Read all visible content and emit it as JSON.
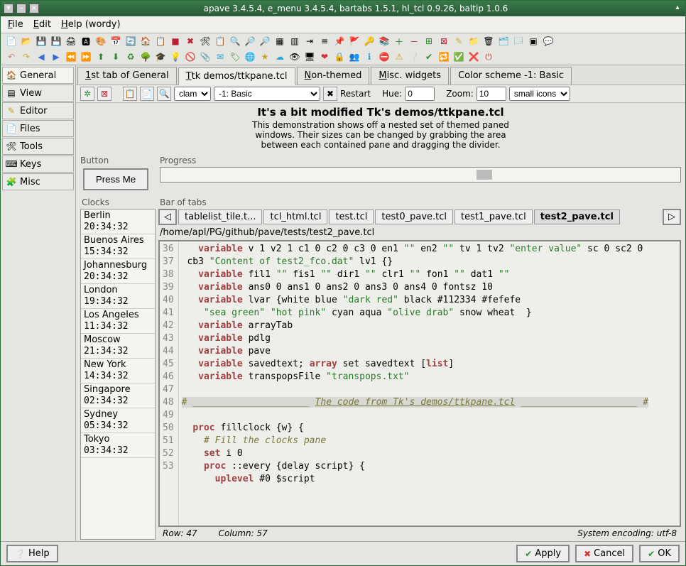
{
  "titlebar": {
    "title": "apave 3.4.5.4,  e_menu 3.4.5.4,  bartabs 1.5.1,  hl_tcl 0.9.26,  baltip 1.0.6"
  },
  "menu": {
    "file": "File",
    "edit": "Edit",
    "help": "Help (wordy)"
  },
  "sidebar": {
    "items": [
      {
        "label": "General"
      },
      {
        "label": "View"
      },
      {
        "label": "Editor"
      },
      {
        "label": "Files"
      },
      {
        "label": "Tools"
      },
      {
        "label": "Keys"
      },
      {
        "label": "Misc"
      }
    ]
  },
  "tabs": [
    {
      "label": "1st tab of General"
    },
    {
      "label": "Ttk demos/ttkpane.tcl"
    },
    {
      "label": "Non-themed"
    },
    {
      "label": "Misc. widgets"
    },
    {
      "label": "Color scheme -1: Basic"
    }
  ],
  "cfg": {
    "theme": "clam",
    "scheme": "-1: Basic",
    "restart": "Restart",
    "hue_lbl": "Hue:",
    "hue": "0",
    "zoom_lbl": "Zoom:",
    "zoom": "10",
    "iconset": "small icons"
  },
  "demo": {
    "title": "It's a bit modified Tk's demos/ttkpane.tcl",
    "desc": "This demonstration shows off a nested set of themed paned windows. Their sizes can be changed by grabbing the area between each contained pane and dragging the divider."
  },
  "button_panel": {
    "label": "Button",
    "text": "Press Me"
  },
  "progress_panel": {
    "label": "Progress"
  },
  "clocks": {
    "label": "Clocks",
    "items": [
      {
        "city": "Berlin",
        "time": "20:34:32"
      },
      {
        "city": "Buenos Aires",
        "time": "15:34:32"
      },
      {
        "city": "Johannesburg",
        "time": "20:34:32"
      },
      {
        "city": "London",
        "time": "19:34:32"
      },
      {
        "city": "Los Angeles",
        "time": "11:34:32"
      },
      {
        "city": "Moscow",
        "time": "21:34:32"
      },
      {
        "city": "New York",
        "time": "14:34:32"
      },
      {
        "city": "Singapore",
        "time": "02:34:32"
      },
      {
        "city": "Sydney",
        "time": "05:34:32"
      },
      {
        "city": "Tokyo",
        "time": "03:34:32"
      }
    ]
  },
  "bar": {
    "label": "Bar of tabs",
    "tabs": [
      {
        "label": "tablelist_tile.t..."
      },
      {
        "label": "tcl_html.tcl"
      },
      {
        "label": "test.tcl"
      },
      {
        "label": "test0_pave.tcl"
      },
      {
        "label": "test1_pave.tcl"
      },
      {
        "label": "test2_pave.tcl"
      }
    ]
  },
  "path": "/home/apl/PG/github/pave/tests/test2_pave.tcl",
  "status": {
    "row": "Row: 47",
    "col": "Column: 57",
    "enc": "System encoding: utf-8"
  },
  "footer": {
    "help": "Help",
    "apply": "Apply",
    "cancel": "Cancel",
    "ok": "OK"
  }
}
